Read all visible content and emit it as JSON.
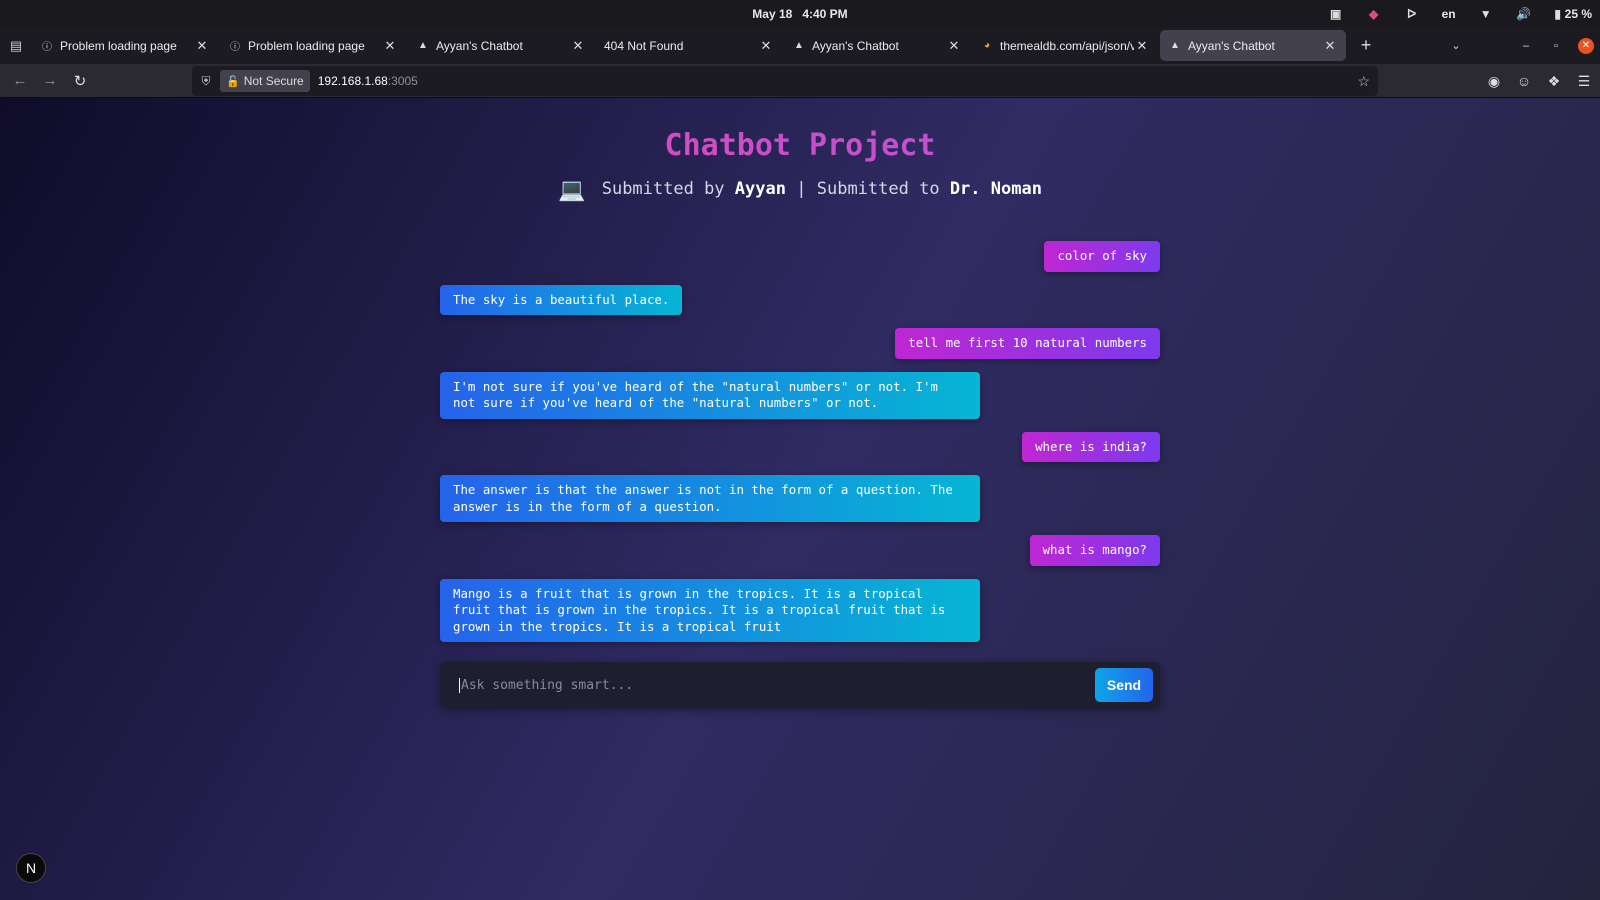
{
  "os": {
    "date": "May 18",
    "time": "4:40 PM",
    "language": "en",
    "battery": "25 %"
  },
  "browser": {
    "tabs": [
      {
        "title": "Problem loading page",
        "icon": "info-icon",
        "active": false
      },
      {
        "title": "Problem loading page",
        "icon": "info-icon",
        "active": false
      },
      {
        "title": "Ayyan's Chatbot",
        "icon": "triangle-icon",
        "active": false
      },
      {
        "title": "404 Not Found",
        "icon": "",
        "active": false
      },
      {
        "title": "Ayyan's Chatbot",
        "icon": "triangle-icon",
        "active": false
      },
      {
        "title": "themealdb.com/api/json/v",
        "icon": "bowl-icon",
        "active": false
      },
      {
        "title": "Ayyan's Chatbot",
        "icon": "triangle-icon",
        "active": true
      }
    ],
    "security_label": "Not Secure",
    "url_host": "192.168.1.68",
    "url_port": ":3005"
  },
  "page": {
    "title": "Chatbot Project",
    "subtitle": {
      "prefix": "Submitted by",
      "author": "Ayyan",
      "separator": "|",
      "middle": "Submitted to",
      "supervisor": "Dr. Noman"
    },
    "messages": [
      {
        "role": "user",
        "text": "color of sky"
      },
      {
        "role": "bot",
        "text": "The sky is a beautiful place."
      },
      {
        "role": "user",
        "text": "tell me first 10 natural numbers"
      },
      {
        "role": "bot",
        "text": "I'm not sure if you've heard of the \"natural numbers\" or not. I'm not sure if you've heard of the \"natural numbers\" or not."
      },
      {
        "role": "user",
        "text": "where is india?"
      },
      {
        "role": "bot",
        "text": "The answer is that the answer is not in the form of a question. The answer is in the form of a question."
      },
      {
        "role": "user",
        "text": "what is mango?"
      },
      {
        "role": "bot",
        "text": "Mango is a fruit that is grown in the tropics. It is a tropical fruit that is grown in the tropics. It is a tropical fruit that is grown in the tropics. It is a tropical fruit"
      }
    ],
    "input": {
      "placeholder": "Ask something smart...",
      "value": ""
    },
    "send_label": "Send",
    "badge_letter": "N"
  },
  "colors": {
    "user_bubble": "#a855f7",
    "bot_bubble": "#06b6d4",
    "title_gradient_start": "#ec4899",
    "title_gradient_end": "#a855f7"
  }
}
